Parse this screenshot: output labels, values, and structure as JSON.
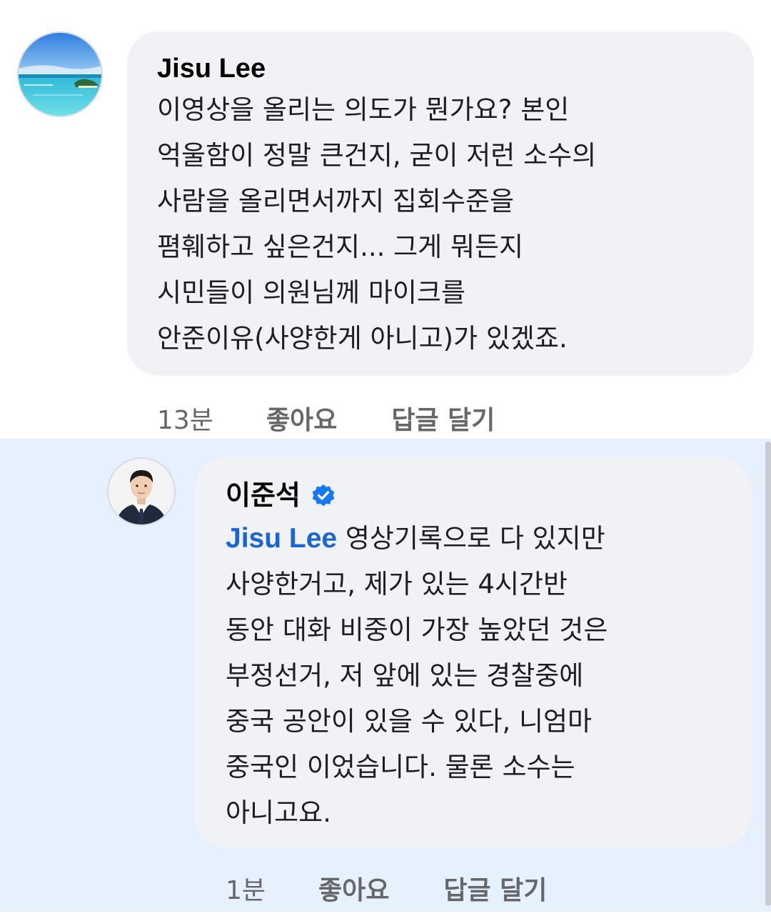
{
  "comments": [
    {
      "author": "Jisu Lee",
      "avatar_icon": "beach-photo-avatar",
      "text": "이영상을 올리는 의도가 뭔가요? 본인\n억울함이 정말 큰건지, 굳이 저런 소수의\n사람을 올리면서까지 집회수준을\n폄훼하고 싶은건지... 그게 뭐든지\n시민들이 의원님께 마이크를\n안준이유(사양한게 아니고)가 있겠죠.",
      "time": "13분",
      "like_label": "좋아요",
      "reply_label": "답글 달기"
    },
    {
      "author": "이준석",
      "avatar_icon": "profile-photo-avatar",
      "verified_icon": "verified-badge-icon",
      "mention": "Jisu Lee",
      "text": " 영상기록으로 다 있지만\n사양한거고, 제가 있는 4시간반\n동안 대화 비중이 가장 높았던 것은\n부정선거, 저 앞에 있는 경찰중에\n중국 공안이 있을 수 있다, 니엄마\n중국인 이었습니다. 물론 소수는\n아니고요.",
      "time": "1분",
      "like_label": "좋아요",
      "reply_label": "답글 달기"
    }
  ],
  "colors": {
    "reply_highlight_bg": "#e7f1fd",
    "bubble_bg": "#f0f2f5",
    "mention": "#1b64d6",
    "verified": "#1877f2",
    "meta_text": "#65676b"
  }
}
